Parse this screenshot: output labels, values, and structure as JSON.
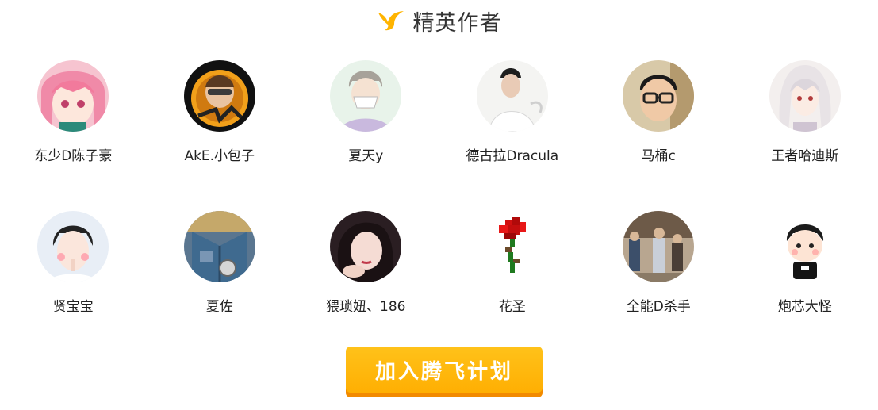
{
  "header": {
    "title": "精英作者",
    "icon": "bird-icon"
  },
  "colors": {
    "accent": "#ffb400",
    "accent_shadow": "#f28a00",
    "title": "#333333"
  },
  "authors": [
    {
      "name": "东少D陈子豪",
      "avatar": "anime-pink-hair"
    },
    {
      "name": "AkE.小包子",
      "avatar": "game-character-logo"
    },
    {
      "name": "夏天y",
      "avatar": "anime-boy-mask"
    },
    {
      "name": "德古拉Dracula",
      "avatar": "photo-man-white-shirt"
    },
    {
      "name": "马桶c",
      "avatar": "photo-man-glasses"
    },
    {
      "name": "王者哈迪斯",
      "avatar": "anime-white-hair"
    },
    {
      "name": "贤宝宝",
      "avatar": "photo-young-man"
    },
    {
      "name": "夏佐",
      "avatar": "photo-denim-jacket"
    },
    {
      "name": "猥琐妞、186",
      "avatar": "photo-young-woman"
    },
    {
      "name": "花圣",
      "avatar": "pixel-rose"
    },
    {
      "name": "全能D杀手",
      "avatar": "photo-outdoor-crowd"
    },
    {
      "name": "炮芯大怪",
      "avatar": "cartoon-chibi-man"
    }
  ],
  "cta": {
    "label": "加入腾飞计划"
  }
}
